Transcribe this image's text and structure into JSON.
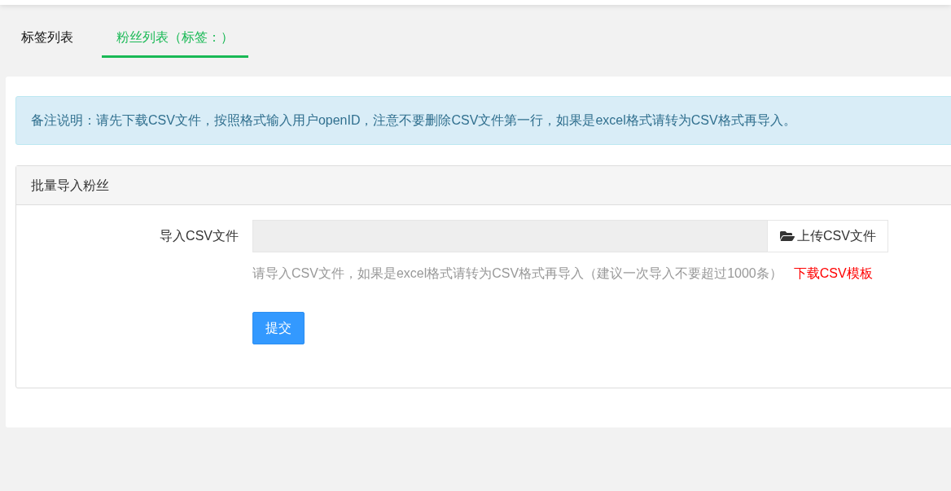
{
  "tabs": [
    {
      "label": "标签列表",
      "selected": false
    },
    {
      "label": "粉丝列表（标签：）",
      "selected": true
    }
  ],
  "notice": "备注说明：请先下载CSV文件，按照格式输入用户openID，注意不要删除CSV文件第一行，如果是excel格式请转为CSV格式再导入。",
  "panel": {
    "title": "批量导入粉丝",
    "form": {
      "label": "导入CSV文件",
      "upload_button": "上传CSV文件",
      "help": "请导入CSV文件，如果是excel格式请转为CSV格式再导入（建议一次导入不要超过1000条）",
      "template_link": "下载CSV模板"
    },
    "submit": "提交"
  }
}
